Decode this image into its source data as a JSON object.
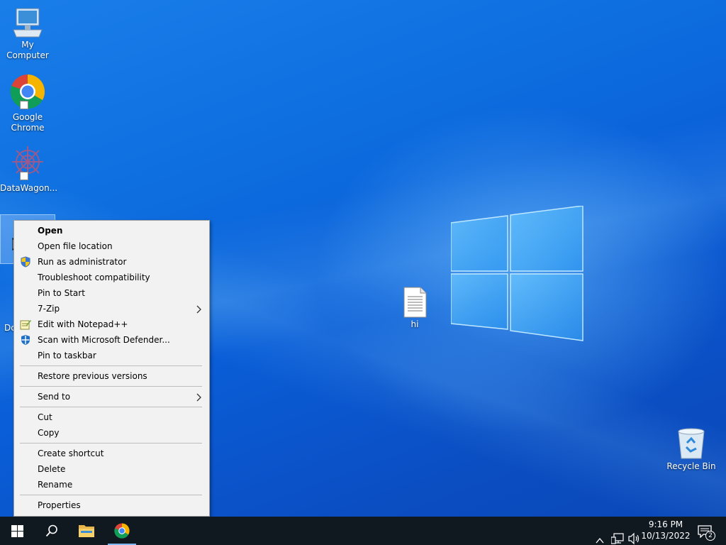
{
  "desktop": {
    "icons": [
      {
        "label": "My Computer"
      },
      {
        "label": "Google Chrome"
      },
      {
        "label": "DataWagon..."
      },
      {
        "label": "Dc"
      },
      {
        "label": "hi"
      },
      {
        "label": "Recycle Bin"
      }
    ]
  },
  "context_menu": {
    "items": [
      {
        "label": "Open",
        "icon": ""
      },
      {
        "label": "Open file location",
        "icon": ""
      },
      {
        "label": "Run as administrator",
        "icon": "uac-shield-icon"
      },
      {
        "label": "Troubleshoot compatibility",
        "icon": ""
      },
      {
        "label": "Pin to Start",
        "icon": ""
      },
      {
        "label": "7-Zip",
        "icon": "",
        "submenu": true
      },
      {
        "label": "Edit with Notepad++",
        "icon": "notepad-plus-plus-icon"
      },
      {
        "label": "Scan with Microsoft Defender...",
        "icon": "defender-icon"
      },
      {
        "label": "Pin to taskbar",
        "icon": ""
      },
      {
        "label": "Restore previous versions",
        "icon": ""
      },
      {
        "label": "Send to",
        "icon": "",
        "submenu": true
      },
      {
        "label": "Cut",
        "icon": ""
      },
      {
        "label": "Copy",
        "icon": ""
      },
      {
        "label": "Create shortcut",
        "icon": ""
      },
      {
        "label": "Delete",
        "icon": ""
      },
      {
        "label": "Rename",
        "icon": ""
      },
      {
        "label": "Properties",
        "icon": ""
      }
    ]
  },
  "taskbar": {
    "pinned": [
      "start-icon",
      "search-icon",
      "file-explorer-icon",
      "chrome-icon"
    ],
    "active": "chrome-icon"
  },
  "tray": {
    "time": "9:16 PM",
    "date": "10/13/2022",
    "notification_count": "2",
    "icons": [
      "chevron-up-icon",
      "network-icon",
      "volume-icon",
      "action-center-icon"
    ]
  },
  "colors": {
    "accent": "#0a63d8",
    "taskbar": "#101820",
    "menu_bg": "#f2f2f2"
  }
}
